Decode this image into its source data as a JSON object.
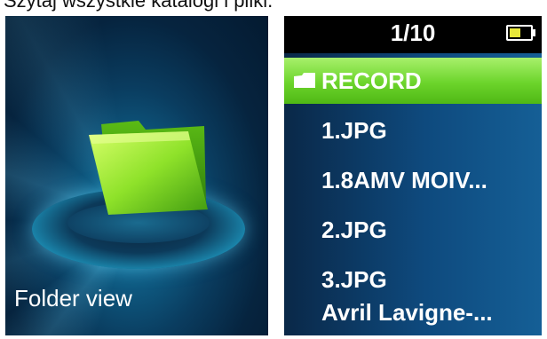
{
  "caption": "Szytaj wszystkie katalogi i pliki.",
  "left_screen": {
    "label": "Folder view",
    "icon": "folder-icon"
  },
  "right_screen": {
    "page_indicator": "1/10",
    "battery_icon": "battery-icon",
    "selected_index": 0,
    "items": [
      {
        "label": "RECORD",
        "type": "folder"
      },
      {
        "label": "1.JPG",
        "type": "file"
      },
      {
        "label": "1.8AMV MOIV...",
        "type": "file"
      },
      {
        "label": "2.JPG",
        "type": "file"
      },
      {
        "label": "3.JPG",
        "type": "file"
      },
      {
        "label": "Avril Lavigne-...",
        "type": "file"
      }
    ]
  },
  "colors": {
    "selection": "#6cd42b",
    "folder_green": "#7ad31f"
  }
}
